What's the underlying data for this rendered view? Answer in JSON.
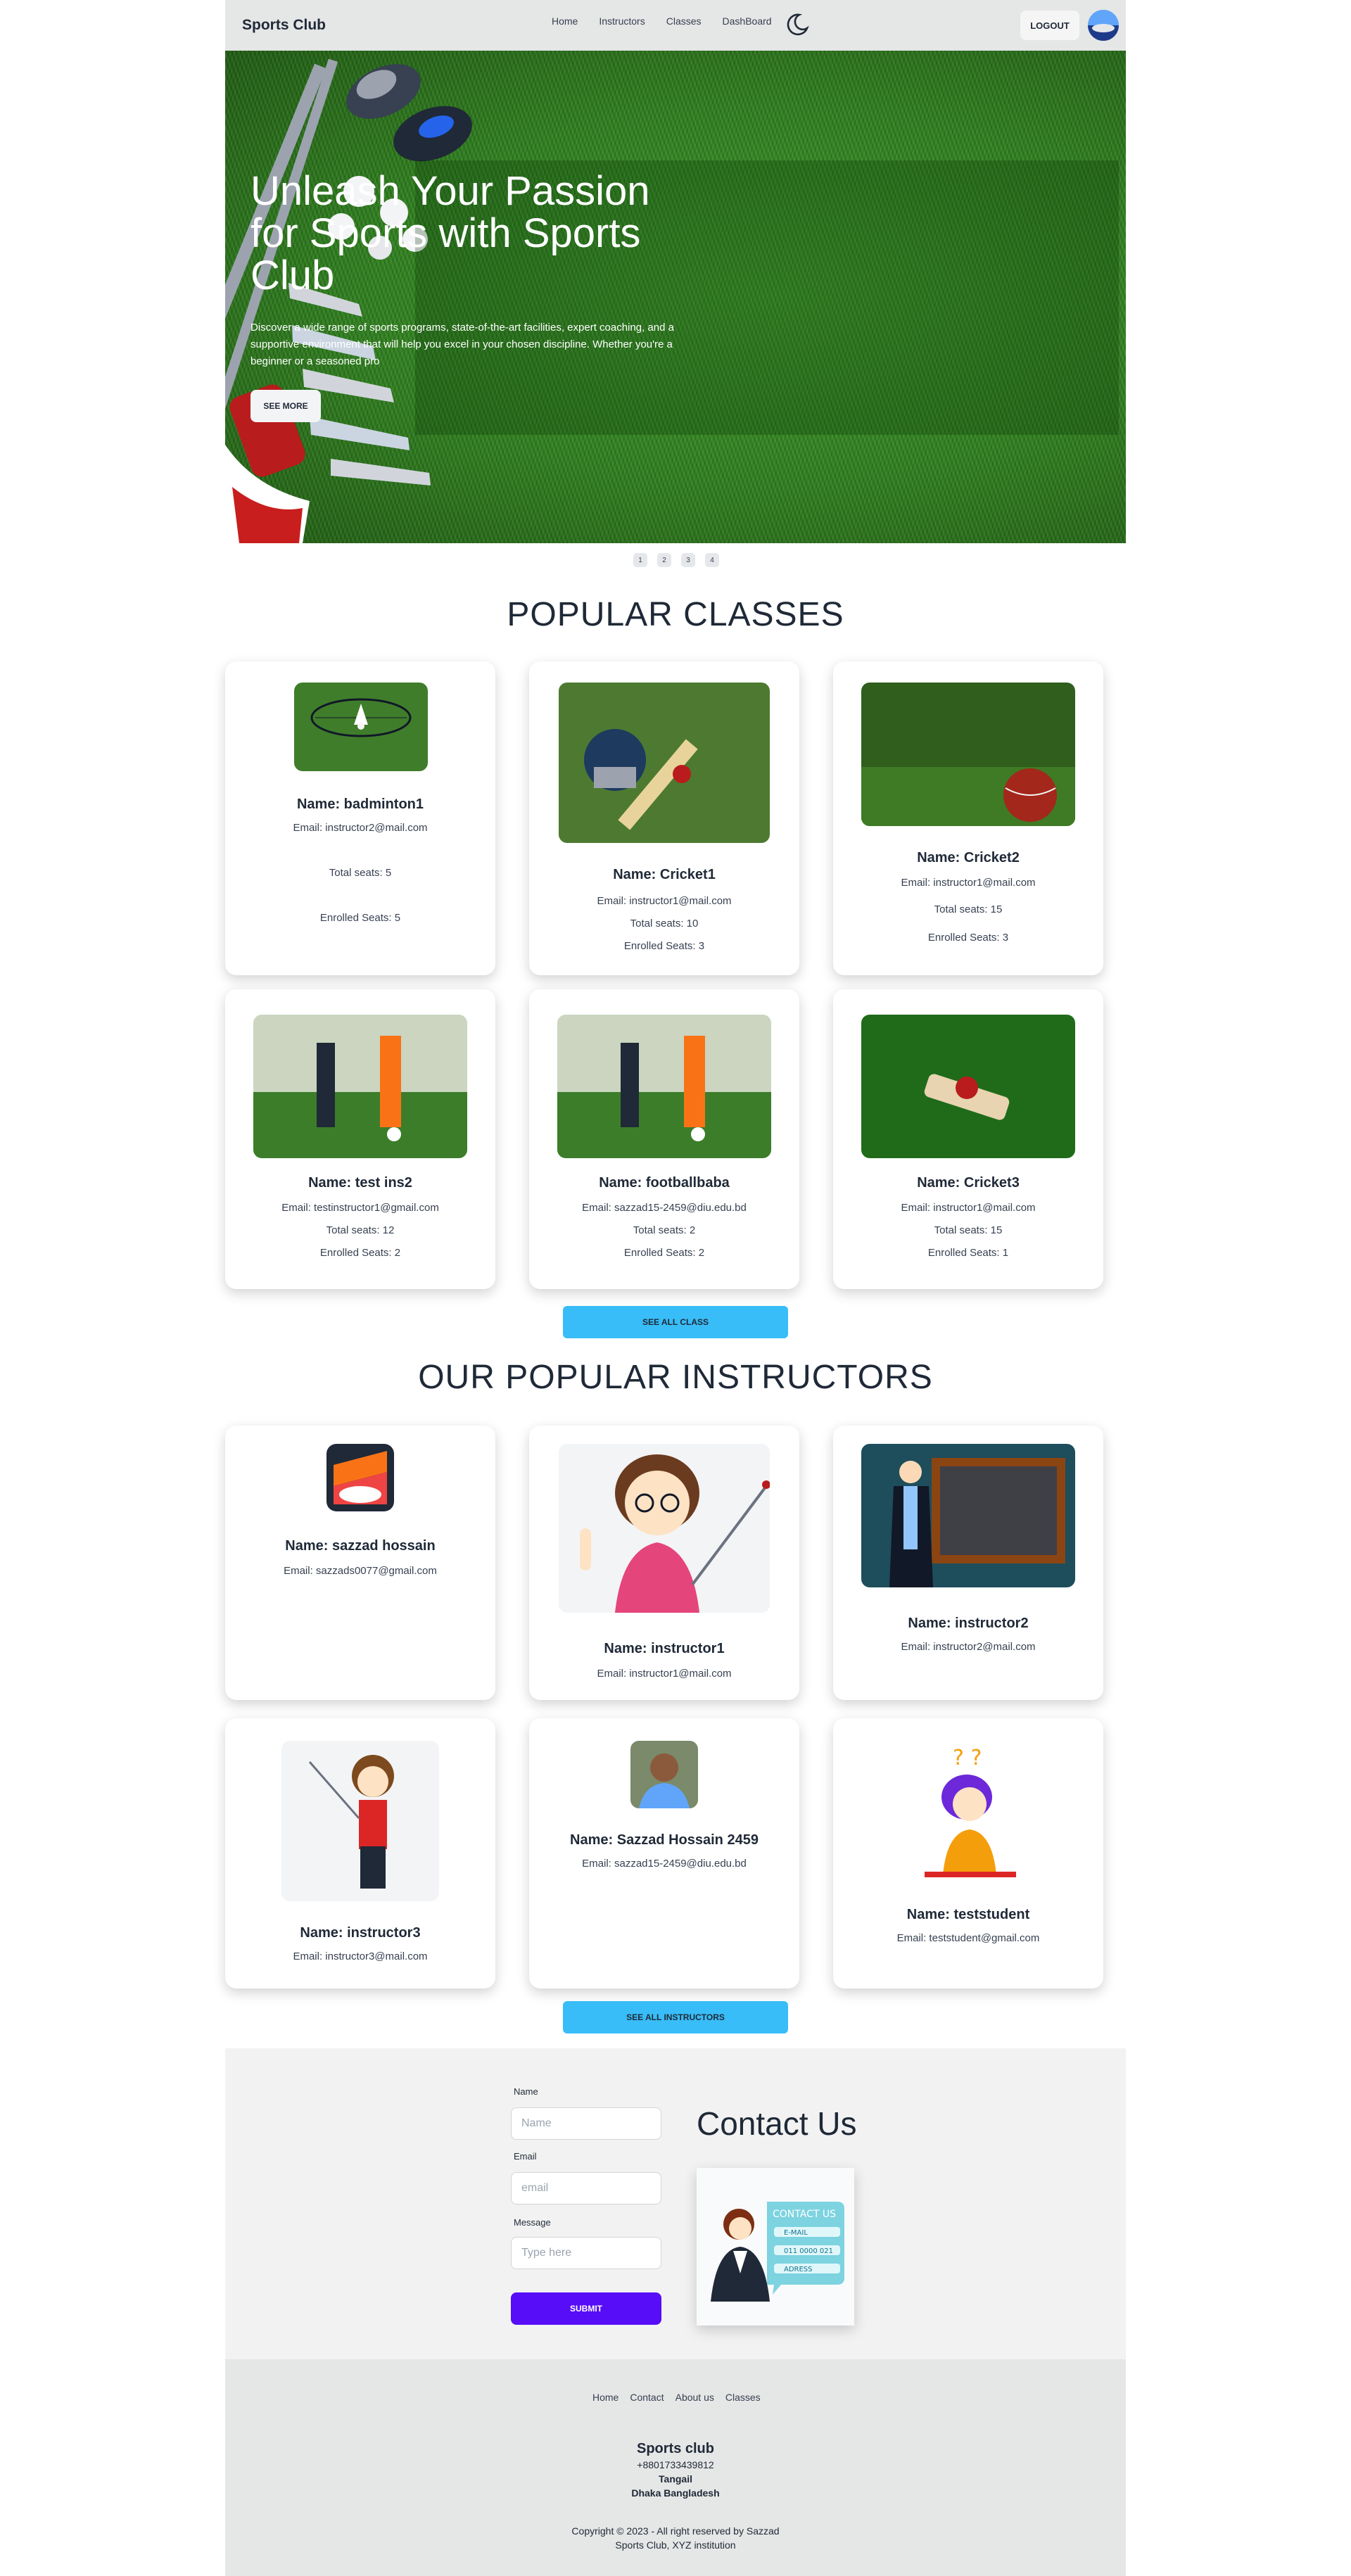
{
  "navbar": {
    "brand": "Sports Club",
    "links": [
      "Home",
      "Instructors",
      "Classes",
      "DashBoard"
    ],
    "logout": "LOGOUT"
  },
  "hero": {
    "title": "Unleash Your Passion for Sports with Sports Club",
    "description": "Discover a wide range of sports programs, state-of-the-art facilities, expert coaching, and a supportive environment that will help you excel in your chosen discipline. Whether you're a beginner or a seasoned pro",
    "button": "SEE MORE",
    "pages": [
      "1",
      "2",
      "3",
      "4"
    ]
  },
  "classes": {
    "title": "POPULAR CLASSES",
    "items": [
      {
        "name": "Name: badminton1",
        "email": "Email: instructor2@mail.com",
        "seats": "Total seats: 5",
        "enrolled": "Enrolled Seats: 5"
      },
      {
        "name": "Name: Cricket1",
        "email": "Email: instructor1@mail.com",
        "seats": "Total seats: 10",
        "enrolled": "Enrolled Seats: 3"
      },
      {
        "name": "Name: Cricket2",
        "email": "Email: instructor1@mail.com",
        "seats": "Total seats: 15",
        "enrolled": "Enrolled Seats: 3"
      },
      {
        "name": "Name: test ins2",
        "email": "Email: testinstructor1@gmail.com",
        "seats": "Total seats: 12",
        "enrolled": "Enrolled Seats: 2"
      },
      {
        "name": "Name: footballbaba",
        "email": "Email: sazzad15-2459@diu.edu.bd",
        "seats": "Total seats: 2",
        "enrolled": "Enrolled Seats: 2"
      },
      {
        "name": "Name: Cricket3",
        "email": "Email: instructor1@mail.com",
        "seats": "Total seats: 15",
        "enrolled": "Enrolled Seats: 1"
      }
    ],
    "button": "SEE ALL CLASS"
  },
  "instructors": {
    "title": "OUR POPULAR INSTRUCTORS",
    "items": [
      {
        "name": "Name: sazzad hossain",
        "email": "Email: sazzads0077@gmail.com"
      },
      {
        "name": "Name: instructor1",
        "email": "Email: instructor1@mail.com"
      },
      {
        "name": "Name: instructor2",
        "email": "Email: instructor2@mail.com"
      },
      {
        "name": "Name: instructor3",
        "email": "Email: instructor3@mail.com"
      },
      {
        "name": "Name: Sazzad Hossain 2459",
        "email": "Email: sazzad15-2459@diu.edu.bd"
      },
      {
        "name": "Name: teststudent",
        "email": "Email: teststudent@gmail.com"
      }
    ],
    "button": "SEE ALL INSTRUCTORS"
  },
  "contact": {
    "name_label": "Name",
    "name_placeholder": "Name",
    "email_label": "Email",
    "email_placeholder": "email",
    "message_label": "Message",
    "message_placeholder": "Type here",
    "submit": "SUBMIT",
    "title": "Contact Us",
    "img_heading": "CONTACT US",
    "img_email": "E-MAIL",
    "img_phone": "011 0000 021",
    "img_address": "ADRESS"
  },
  "footer": {
    "links": [
      "Home",
      "Contact",
      "About us",
      "Classes"
    ],
    "org": "Sports club",
    "phone": "+8801733439812",
    "city": "Tangail",
    "country": "Dhaka Bangladesh",
    "copyright": "Copyright © 2023 - All right reserved by Sazzad",
    "institution": "Sports Club, XYZ institution"
  }
}
